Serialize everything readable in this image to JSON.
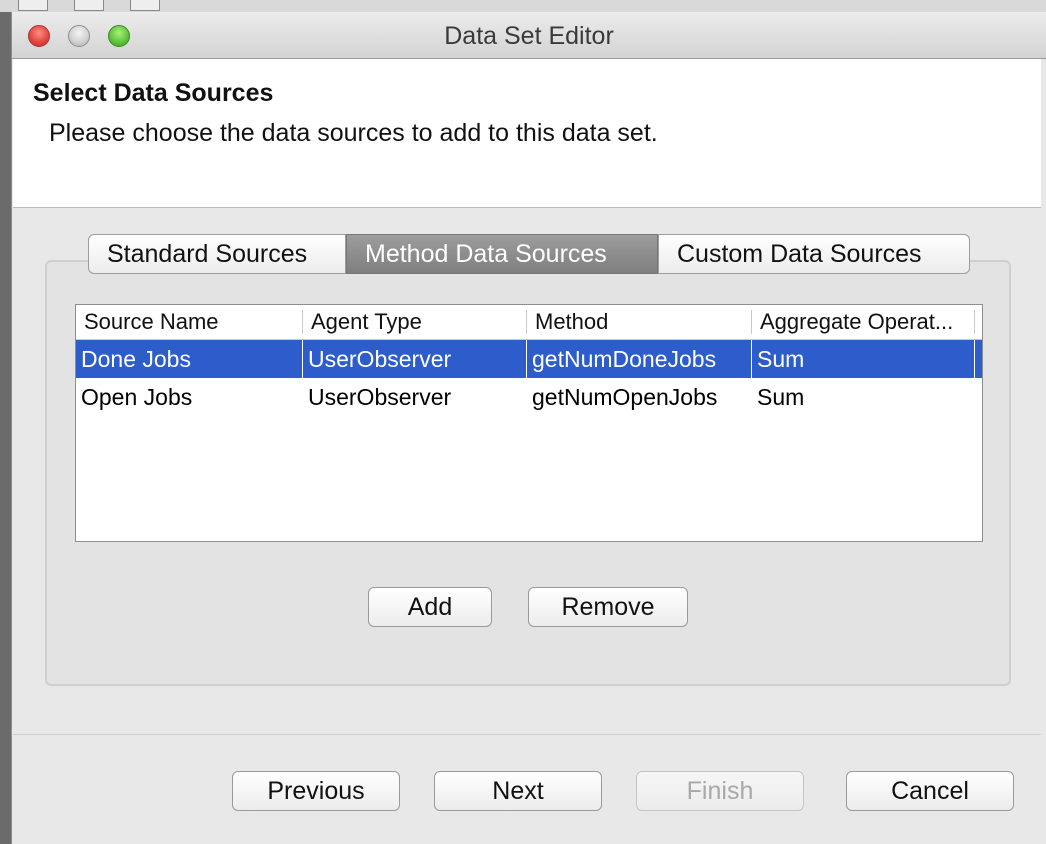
{
  "window": {
    "title": "Data Set Editor"
  },
  "header": {
    "title": "Select Data Sources",
    "subtitle": "Please choose the data sources to add to this data set."
  },
  "tabs": [
    {
      "label": "Standard Sources",
      "active": false
    },
    {
      "label": "Method Data Sources",
      "active": true
    },
    {
      "label": "Custom Data Sources",
      "active": false
    }
  ],
  "table": {
    "columns": [
      "Source Name",
      "Agent Type",
      "Method",
      "Aggregate Operat..."
    ],
    "rows": [
      {
        "source_name": "Done Jobs",
        "agent_type": "UserObserver",
        "method": "getNumDoneJobs",
        "aggregate": "Sum",
        "selected": true
      },
      {
        "source_name": "Open Jobs",
        "agent_type": "UserObserver",
        "method": "getNumOpenJobs",
        "aggregate": "Sum",
        "selected": false
      }
    ]
  },
  "panel_buttons": {
    "add": "Add",
    "remove": "Remove"
  },
  "footer_buttons": {
    "previous": "Previous",
    "next": "Next",
    "finish": "Finish",
    "cancel": "Cancel"
  },
  "colors": {
    "selection": "#2d5dcb",
    "active_tab": "#8e8e8e"
  }
}
